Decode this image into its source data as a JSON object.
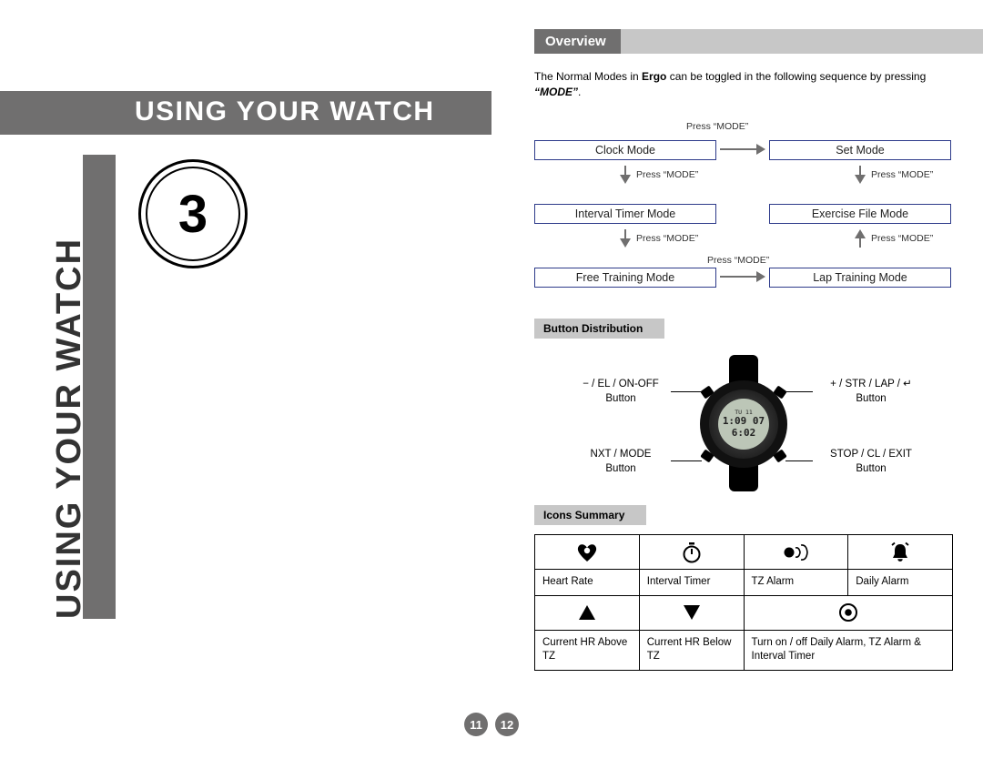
{
  "left": {
    "chapter_number": "3",
    "chapter_title": "USING YOUR WATCH",
    "vertical_title": "USING YOUR WATCH",
    "page_number": "11"
  },
  "right": {
    "overview_label": "Overview",
    "intro_pre": "The Normal Modes in ",
    "intro_brand": "Ergo",
    "intro_mid": " can be toggled in the following sequence by pressing ",
    "intro_mode": "“MODE”",
    "intro_post": ".",
    "press_mode": "Press “MODE”",
    "modes": {
      "clock": "Clock Mode",
      "set": "Set Mode",
      "interval": "Interval Timer Mode",
      "exercise": "Exercise File Mode",
      "freetrain": "Free Training Mode",
      "laptrain": "Lap Training Mode"
    },
    "section_button_dist": "Button Distribution",
    "button_labels": {
      "tl_l1": "− / EL / ON-OFF",
      "tl_l2": "Button",
      "bl_l1": "NXT / MODE",
      "bl_l2": "Button",
      "tr_l1": "+ / STR / LAP / ↵",
      "tr_l2": "Button",
      "br_l1": "STOP / CL / EXIT",
      "br_l2": "Button"
    },
    "watch_screen": {
      "l1": "TU 11",
      "l2": "1:09 07",
      "l3": "6:02"
    },
    "section_icons": "Icons Summary",
    "icons": {
      "row1": {
        "c1": "Heart Rate",
        "c2": "Interval Timer",
        "c3": "TZ Alarm",
        "c4": "Daily Alarm"
      },
      "row2": {
        "c1": "Current HR Above TZ",
        "c2": "Current HR Below TZ",
        "c34": "Turn on / off Daily Alarm, TZ Alarm & Interval Timer"
      }
    },
    "page_number": "12"
  }
}
